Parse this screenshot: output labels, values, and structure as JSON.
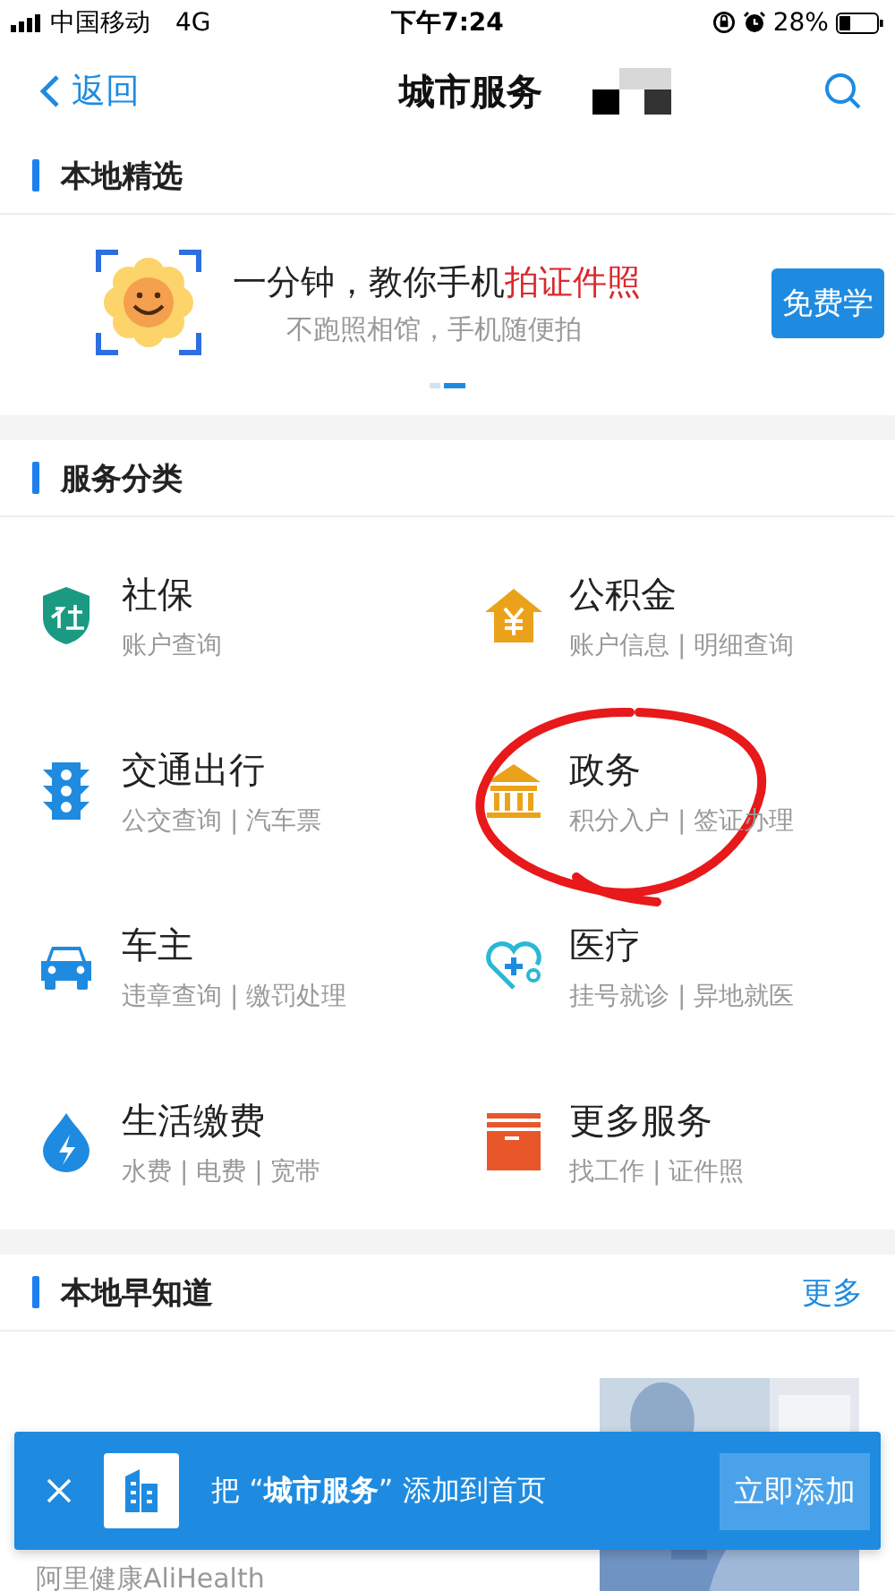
{
  "status_bar": {
    "carrier": "中国移动",
    "network": "4G",
    "time": "下午7:24",
    "battery": "28%"
  },
  "nav": {
    "back": "返回",
    "title": "城市服务"
  },
  "featured": {
    "heading": "本地精选",
    "promo": {
      "title": "一分钟，教你手机**拍证件照**",
      "subtitle": "不跑照相馆，手机随便拍",
      "button": "免费学"
    },
    "dots": [
      {
        "selected": false
      },
      {
        "selected": true
      }
    ]
  },
  "services": {
    "heading": "服务分类",
    "items": [
      {
        "kind": "shield",
        "name": "社保",
        "desc": "账户查询"
      },
      {
        "kind": "house",
        "name": "公积金",
        "desc": "账户信息 | 明细查询"
      },
      {
        "kind": "traffic",
        "name": "交通出行",
        "desc": "公交查询 | 汽车票"
      },
      {
        "kind": "bank",
        "name": "政务",
        "desc": "积分入户 | 签证办理"
      },
      {
        "kind": "car",
        "name": "车主",
        "desc": "违章查询 | 缴罚处理"
      },
      {
        "kind": "medical",
        "name": "医疗",
        "desc": "挂号就诊 | 异地就医"
      },
      {
        "kind": "drop",
        "name": "生活缴费",
        "desc": "水费 | 电费 | 宽带"
      },
      {
        "kind": "box",
        "name": "更多服务",
        "desc": "找工作 | 证件照"
      }
    ]
  },
  "news": {
    "heading": "本地早知道",
    "more": "更多",
    "source": "阿里健康AliHealth"
  },
  "add_banner": {
    "text": "把 “**城市服务**” 添加到首页",
    "button": "立即添加"
  }
}
